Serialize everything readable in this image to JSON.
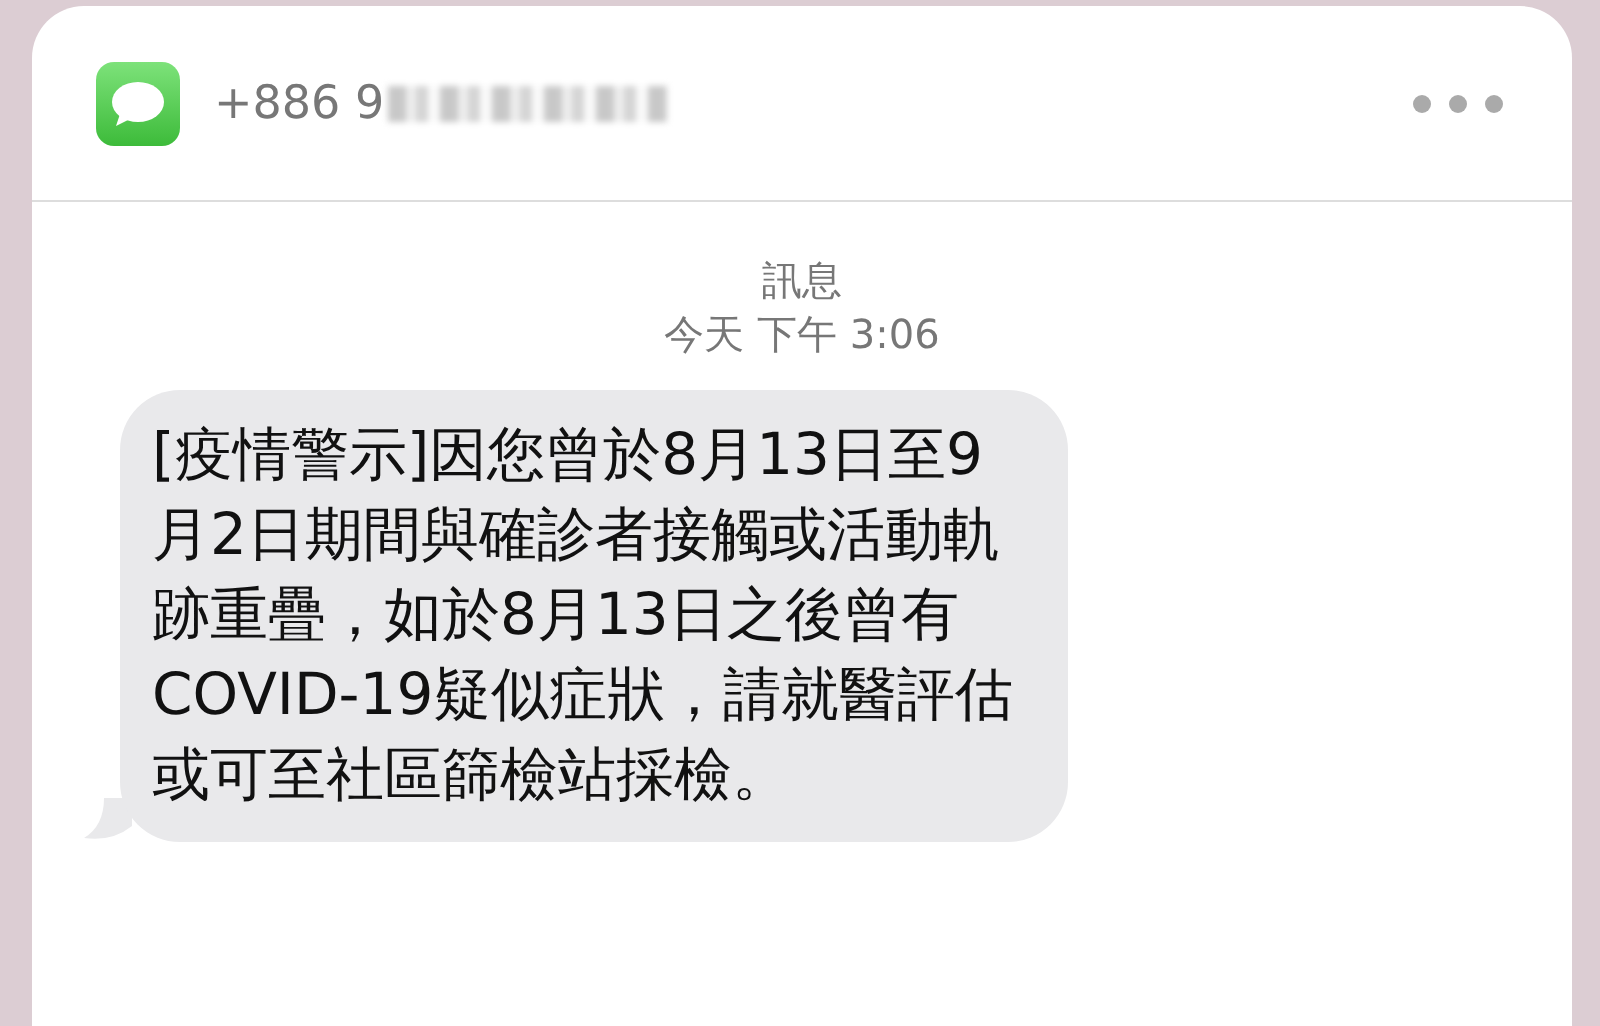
{
  "header": {
    "sender": "+886 9",
    "sender_redacted": true
  },
  "conversation": {
    "app_name": "訊息",
    "timestamp": "今天 下午 3:06"
  },
  "messages": [
    {
      "kind": "incoming",
      "text": "[疫情警示]因您曾於8月13日至9月2日期間與確診者接觸或活動軌跡重疊，如於8月13日之後曾有COVID-19疑似症狀，請就醫評估或可至社區篩檢站採檢。"
    }
  ]
}
